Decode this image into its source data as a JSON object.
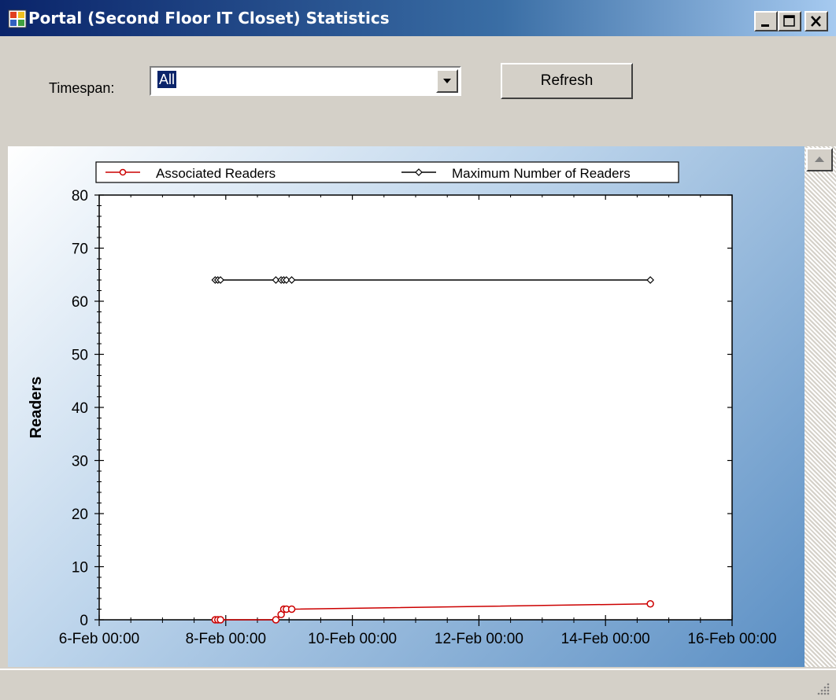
{
  "window": {
    "title": "Portal (Second Floor IT Closet) Statistics",
    "title_bar_color": "#0a246a"
  },
  "controls": {
    "timespan_label": "Timespan:",
    "timespan_value": "All",
    "refresh_label": "Refresh"
  },
  "chart_data": {
    "type": "line",
    "ylabel": "Readers",
    "xlabel": "",
    "ylim": [
      0,
      80
    ],
    "xlim": [
      "2008-02-06T00:00",
      "2008-02-16T00:00"
    ],
    "y_ticks": [
      "0",
      "10",
      "20",
      "30",
      "40",
      "50",
      "60",
      "70",
      "80"
    ],
    "x_ticks": [
      "6-Feb 00:00",
      "8-Feb 00:00",
      "10-Feb 00:00",
      "12-Feb 00:00",
      "14-Feb 00:00",
      "16-Feb 00:00"
    ],
    "legend_position": "top",
    "grid": false,
    "series": [
      {
        "name": "Associated Readers",
        "color": "#cc0000",
        "marker": "circle",
        "points": [
          {
            "x": "2008-02-07T20:00",
            "y": 0
          },
          {
            "x": "2008-02-07T21:00",
            "y": 0
          },
          {
            "x": "2008-02-07T22:00",
            "y": 0
          },
          {
            "x": "2008-02-08T19:00",
            "y": 0
          },
          {
            "x": "2008-02-08T21:00",
            "y": 1
          },
          {
            "x": "2008-02-08T22:00",
            "y": 2
          },
          {
            "x": "2008-02-08T23:00",
            "y": 2
          },
          {
            "x": "2008-02-09T01:00",
            "y": 2
          },
          {
            "x": "2008-02-14T17:00",
            "y": 3
          }
        ]
      },
      {
        "name": "Maximum Number of Readers",
        "color": "#000000",
        "marker": "diamond",
        "points": [
          {
            "x": "2008-02-07T20:00",
            "y": 64
          },
          {
            "x": "2008-02-07T21:00",
            "y": 64
          },
          {
            "x": "2008-02-07T22:00",
            "y": 64
          },
          {
            "x": "2008-02-08T19:00",
            "y": 64
          },
          {
            "x": "2008-02-08T21:00",
            "y": 64
          },
          {
            "x": "2008-02-08T22:00",
            "y": 64
          },
          {
            "x": "2008-02-08T23:00",
            "y": 64
          },
          {
            "x": "2008-02-09T01:00",
            "y": 64
          },
          {
            "x": "2008-02-14T17:00",
            "y": 64
          }
        ]
      }
    ]
  }
}
